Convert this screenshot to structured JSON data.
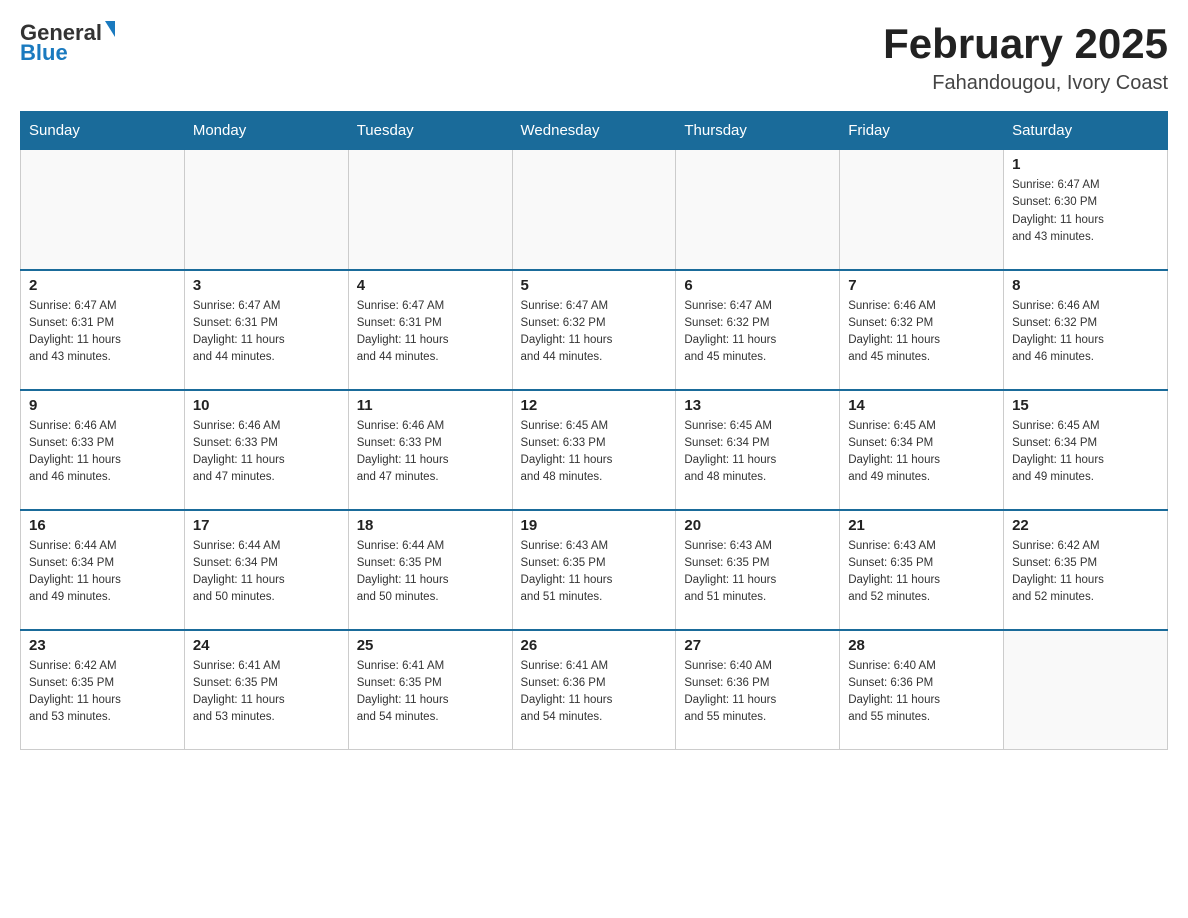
{
  "header": {
    "logo": {
      "general": "General",
      "blue": "Blue"
    },
    "title": "February 2025",
    "location": "Fahandougou, Ivory Coast"
  },
  "weekdays": [
    "Sunday",
    "Monday",
    "Tuesday",
    "Wednesday",
    "Thursday",
    "Friday",
    "Saturday"
  ],
  "weeks": [
    [
      {
        "day": "",
        "info": ""
      },
      {
        "day": "",
        "info": ""
      },
      {
        "day": "",
        "info": ""
      },
      {
        "day": "",
        "info": ""
      },
      {
        "day": "",
        "info": ""
      },
      {
        "day": "",
        "info": ""
      },
      {
        "day": "1",
        "info": "Sunrise: 6:47 AM\nSunset: 6:30 PM\nDaylight: 11 hours\nand 43 minutes."
      }
    ],
    [
      {
        "day": "2",
        "info": "Sunrise: 6:47 AM\nSunset: 6:31 PM\nDaylight: 11 hours\nand 43 minutes."
      },
      {
        "day": "3",
        "info": "Sunrise: 6:47 AM\nSunset: 6:31 PM\nDaylight: 11 hours\nand 44 minutes."
      },
      {
        "day": "4",
        "info": "Sunrise: 6:47 AM\nSunset: 6:31 PM\nDaylight: 11 hours\nand 44 minutes."
      },
      {
        "day": "5",
        "info": "Sunrise: 6:47 AM\nSunset: 6:32 PM\nDaylight: 11 hours\nand 44 minutes."
      },
      {
        "day": "6",
        "info": "Sunrise: 6:47 AM\nSunset: 6:32 PM\nDaylight: 11 hours\nand 45 minutes."
      },
      {
        "day": "7",
        "info": "Sunrise: 6:46 AM\nSunset: 6:32 PM\nDaylight: 11 hours\nand 45 minutes."
      },
      {
        "day": "8",
        "info": "Sunrise: 6:46 AM\nSunset: 6:32 PM\nDaylight: 11 hours\nand 46 minutes."
      }
    ],
    [
      {
        "day": "9",
        "info": "Sunrise: 6:46 AM\nSunset: 6:33 PM\nDaylight: 11 hours\nand 46 minutes."
      },
      {
        "day": "10",
        "info": "Sunrise: 6:46 AM\nSunset: 6:33 PM\nDaylight: 11 hours\nand 47 minutes."
      },
      {
        "day": "11",
        "info": "Sunrise: 6:46 AM\nSunset: 6:33 PM\nDaylight: 11 hours\nand 47 minutes."
      },
      {
        "day": "12",
        "info": "Sunrise: 6:45 AM\nSunset: 6:33 PM\nDaylight: 11 hours\nand 48 minutes."
      },
      {
        "day": "13",
        "info": "Sunrise: 6:45 AM\nSunset: 6:34 PM\nDaylight: 11 hours\nand 48 minutes."
      },
      {
        "day": "14",
        "info": "Sunrise: 6:45 AM\nSunset: 6:34 PM\nDaylight: 11 hours\nand 49 minutes."
      },
      {
        "day": "15",
        "info": "Sunrise: 6:45 AM\nSunset: 6:34 PM\nDaylight: 11 hours\nand 49 minutes."
      }
    ],
    [
      {
        "day": "16",
        "info": "Sunrise: 6:44 AM\nSunset: 6:34 PM\nDaylight: 11 hours\nand 49 minutes."
      },
      {
        "day": "17",
        "info": "Sunrise: 6:44 AM\nSunset: 6:34 PM\nDaylight: 11 hours\nand 50 minutes."
      },
      {
        "day": "18",
        "info": "Sunrise: 6:44 AM\nSunset: 6:35 PM\nDaylight: 11 hours\nand 50 minutes."
      },
      {
        "day": "19",
        "info": "Sunrise: 6:43 AM\nSunset: 6:35 PM\nDaylight: 11 hours\nand 51 minutes."
      },
      {
        "day": "20",
        "info": "Sunrise: 6:43 AM\nSunset: 6:35 PM\nDaylight: 11 hours\nand 51 minutes."
      },
      {
        "day": "21",
        "info": "Sunrise: 6:43 AM\nSunset: 6:35 PM\nDaylight: 11 hours\nand 52 minutes."
      },
      {
        "day": "22",
        "info": "Sunrise: 6:42 AM\nSunset: 6:35 PM\nDaylight: 11 hours\nand 52 minutes."
      }
    ],
    [
      {
        "day": "23",
        "info": "Sunrise: 6:42 AM\nSunset: 6:35 PM\nDaylight: 11 hours\nand 53 minutes."
      },
      {
        "day": "24",
        "info": "Sunrise: 6:41 AM\nSunset: 6:35 PM\nDaylight: 11 hours\nand 53 minutes."
      },
      {
        "day": "25",
        "info": "Sunrise: 6:41 AM\nSunset: 6:35 PM\nDaylight: 11 hours\nand 54 minutes."
      },
      {
        "day": "26",
        "info": "Sunrise: 6:41 AM\nSunset: 6:36 PM\nDaylight: 11 hours\nand 54 minutes."
      },
      {
        "day": "27",
        "info": "Sunrise: 6:40 AM\nSunset: 6:36 PM\nDaylight: 11 hours\nand 55 minutes."
      },
      {
        "day": "28",
        "info": "Sunrise: 6:40 AM\nSunset: 6:36 PM\nDaylight: 11 hours\nand 55 minutes."
      },
      {
        "day": "",
        "info": ""
      }
    ]
  ]
}
